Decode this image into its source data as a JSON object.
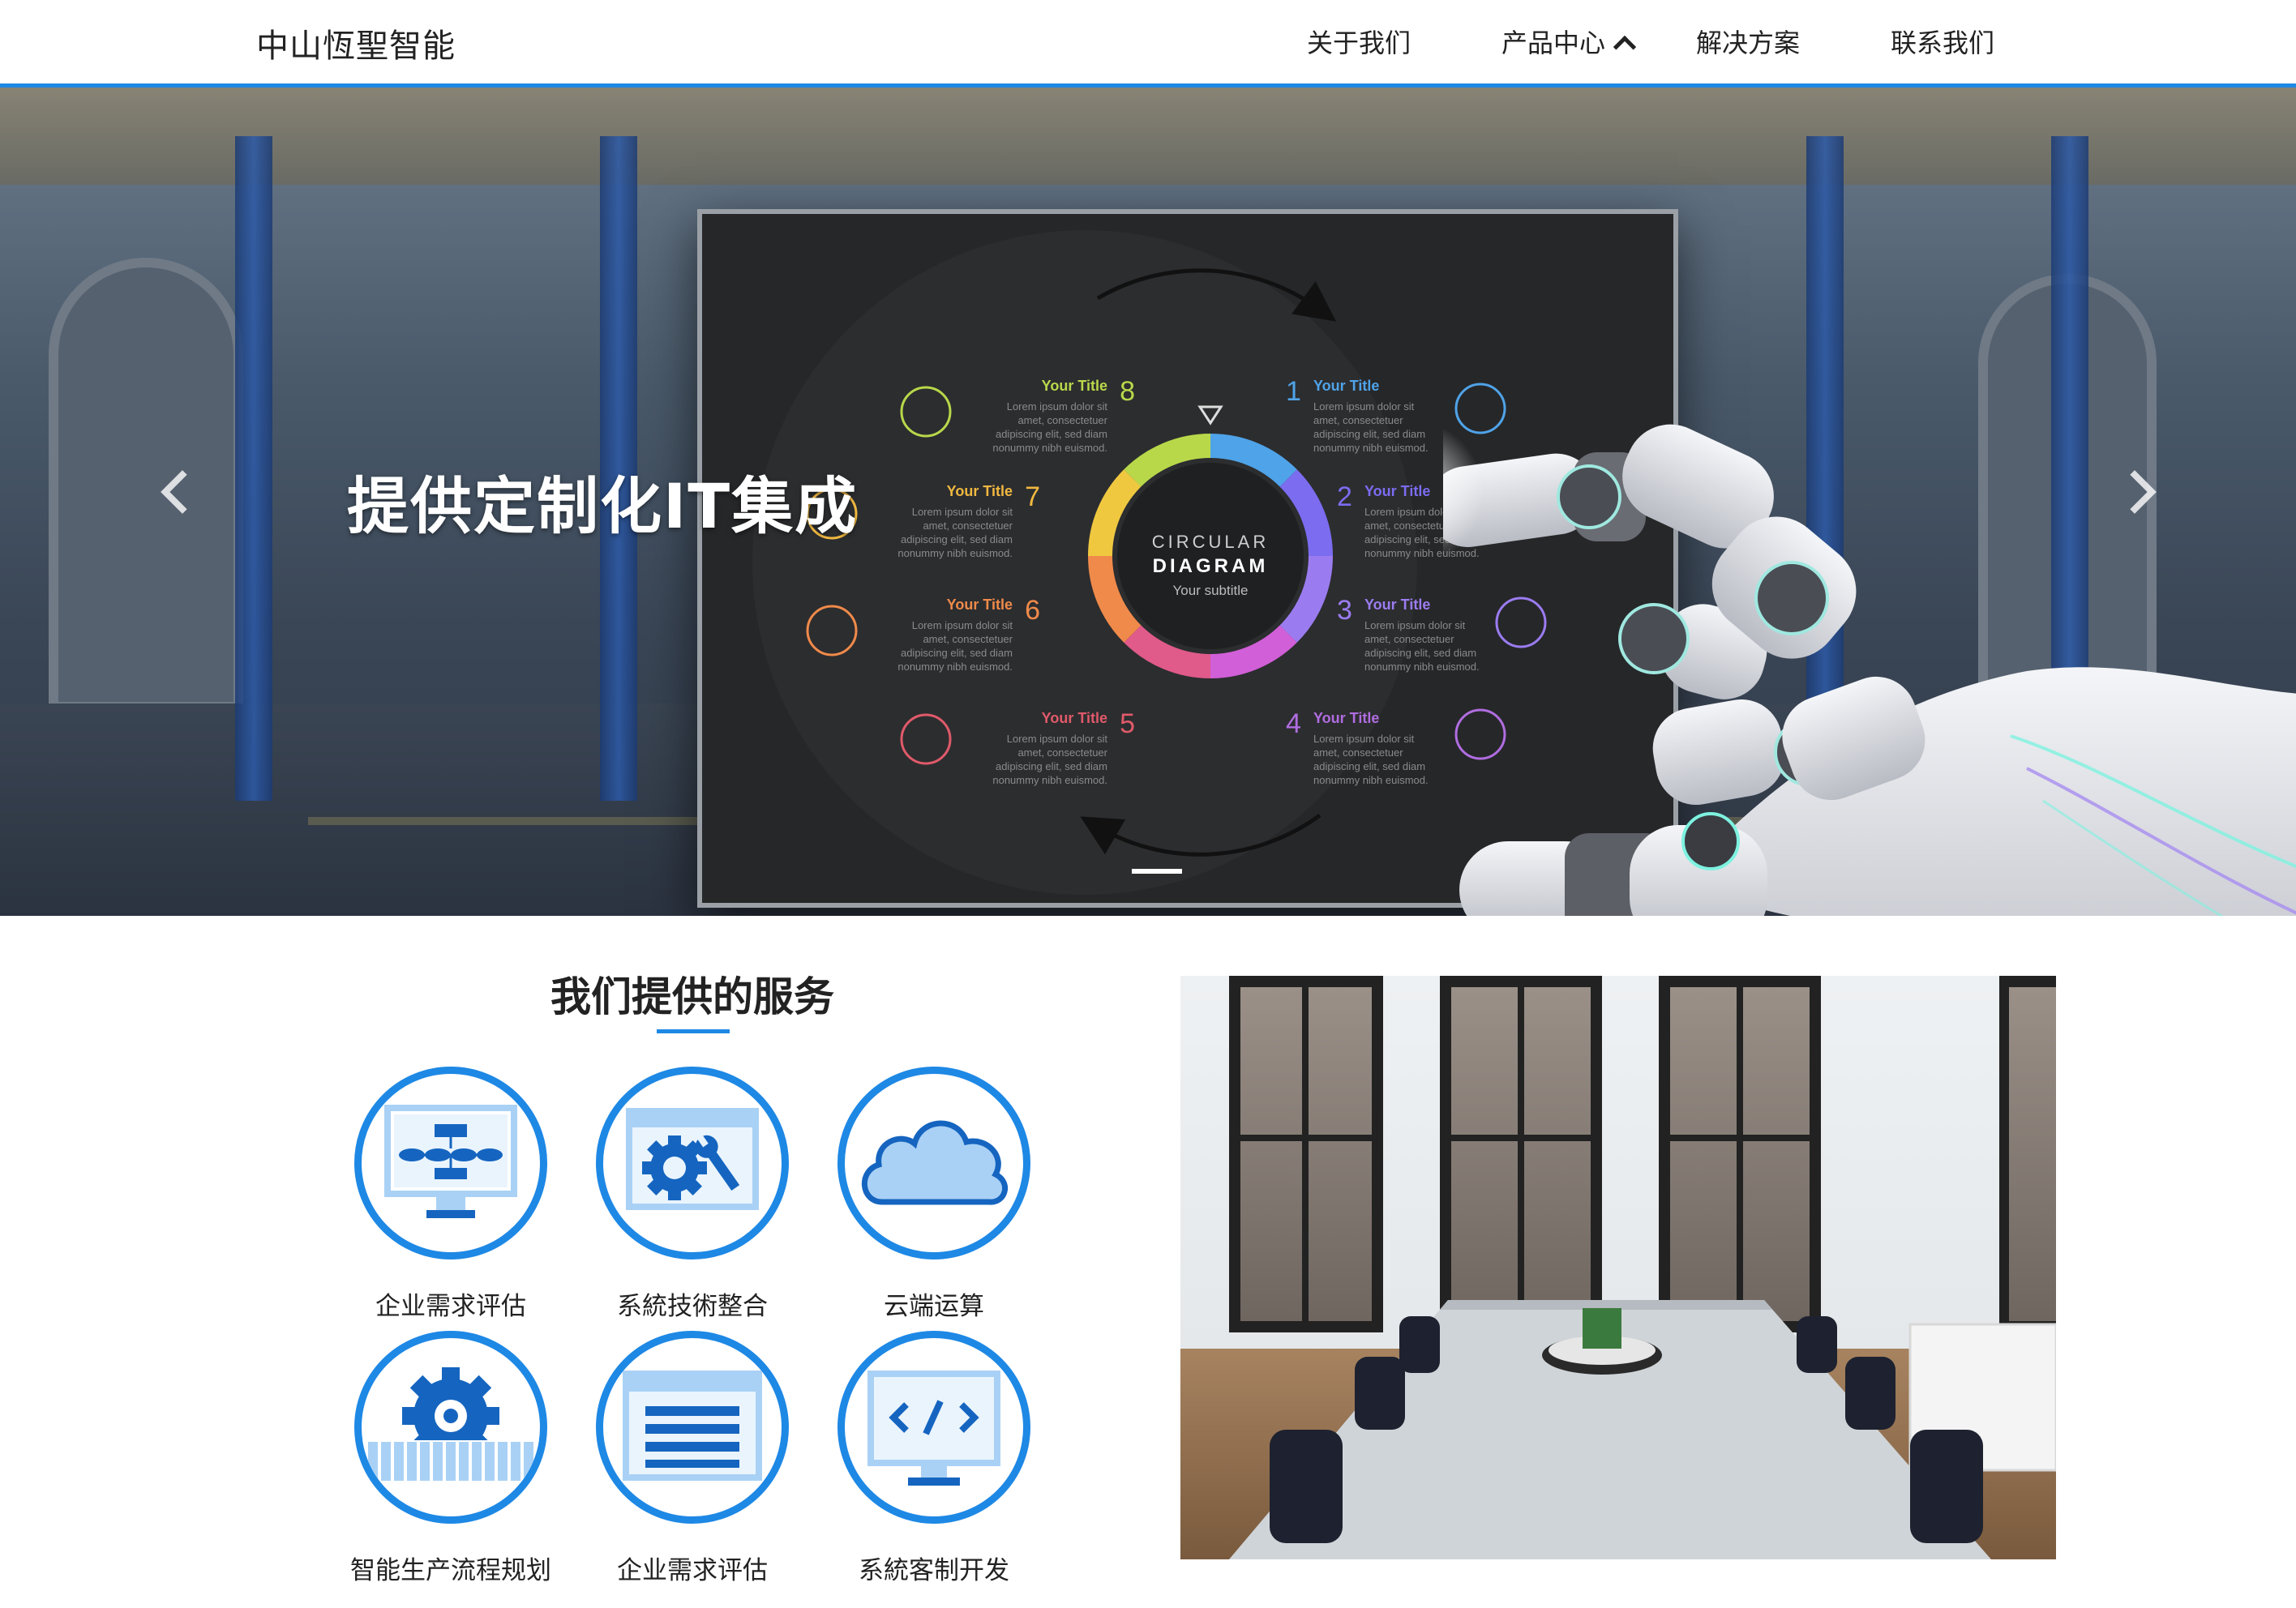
{
  "header": {
    "brand": "中山恆聖智能",
    "nav": {
      "about": "关于我们",
      "products": "产品中心",
      "solutions": "解决方案",
      "contact": "联系我们"
    }
  },
  "hero": {
    "caption": "提供定制化IT集成",
    "diagram": {
      "title_top": "CIRCULAR",
      "title_bottom": "DIAGRAM",
      "subtitle": "Your subtitle",
      "item_title": "Your Title",
      "item_text": [
        "Lorem ipsum dolor sit",
        "amet, consectetuer",
        "adipiscing elit, sed diam",
        "nonummy nibh euismod."
      ],
      "items": [
        {
          "num": "1",
          "color": "#4fa3e8"
        },
        {
          "num": "2",
          "color": "#7b6cf0"
        },
        {
          "num": "3",
          "color": "#9b7cf0"
        },
        {
          "num": "4",
          "color": "#b06de0"
        },
        {
          "num": "5",
          "color": "#e05a6a"
        },
        {
          "num": "6",
          "color": "#f08a4a"
        },
        {
          "num": "7",
          "color": "#f0b840"
        },
        {
          "num": "8",
          "color": "#b8d84a"
        }
      ]
    }
  },
  "services": {
    "title": "我们提供的服务",
    "items": [
      {
        "label": "企业需求评估",
        "icon": "flowchart-monitor-icon"
      },
      {
        "label": "系統技術整合",
        "icon": "gear-wrench-icon"
      },
      {
        "label": "云端运算",
        "icon": "cloud-icon"
      },
      {
        "label": "智能生产流程规划",
        "icon": "gear-conveyor-icon"
      },
      {
        "label": "企业需求评估",
        "icon": "document-window-icon"
      },
      {
        "label": "系統客制开发",
        "icon": "code-monitor-icon"
      }
    ]
  },
  "colors": {
    "accent": "#1e88e5",
    "icon_light": "#a9d1f5"
  }
}
